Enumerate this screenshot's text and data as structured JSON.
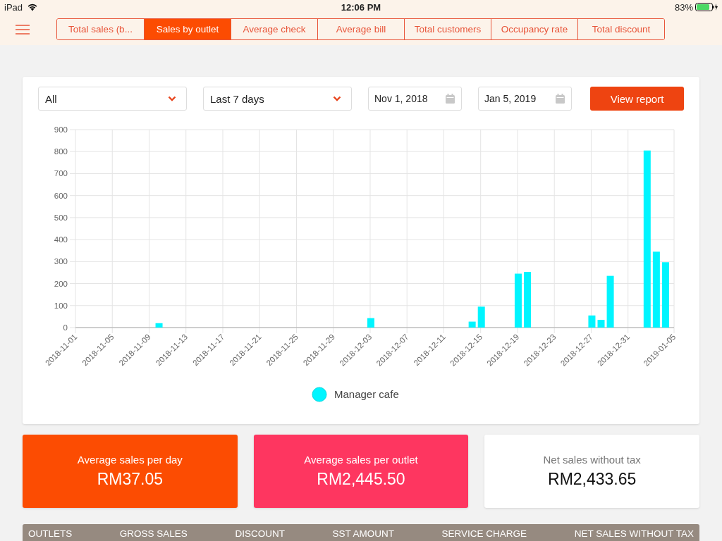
{
  "status_bar": {
    "device": "iPad",
    "time": "12:06 PM",
    "battery": "83%"
  },
  "tabs": [
    {
      "label": "Total sales (b...",
      "selected": false
    },
    {
      "label": "Sales by outlet",
      "selected": true
    },
    {
      "label": "Average check",
      "selected": false
    },
    {
      "label": "Average bill",
      "selected": false
    },
    {
      "label": "Total customers",
      "selected": false
    },
    {
      "label": "Occupancy rate",
      "selected": false
    },
    {
      "label": "Total discount",
      "selected": false
    }
  ],
  "filters": {
    "outlet": "All",
    "period": "Last 7 days",
    "start_date": "Nov 1, 2018",
    "end_date": "Jan 5, 2019",
    "button": "View report"
  },
  "chart_data": {
    "type": "bar",
    "grid": true,
    "categories": [
      "2018-11-01",
      null,
      null,
      null,
      "2018-11-05",
      null,
      null,
      null,
      "2018-11-09",
      null,
      null,
      null,
      "2018-11-13",
      null,
      null,
      null,
      "2018-11-17",
      null,
      null,
      null,
      "2018-11-21",
      null,
      null,
      null,
      "2018-11-25",
      null,
      null,
      null,
      "2018-11-29",
      null,
      null,
      null,
      "2018-12-03",
      null,
      null,
      null,
      "2018-12-07",
      null,
      null,
      null,
      "2018-12-11",
      null,
      null,
      null,
      "2018-12-15",
      null,
      null,
      null,
      "2018-12-19",
      null,
      null,
      null,
      "2018-12-23",
      null,
      null,
      null,
      "2018-12-27",
      null,
      null,
      null,
      "2018-12-31",
      null,
      null,
      null,
      null,
      "2019-01-05"
    ],
    "series": [
      {
        "name": "Manager cafe",
        "color": "#00f5ff",
        "values": [
          null,
          null,
          null,
          null,
          null,
          null,
          null,
          null,
          null,
          20,
          null,
          null,
          null,
          null,
          null,
          null,
          null,
          null,
          null,
          null,
          null,
          null,
          null,
          null,
          null,
          null,
          null,
          null,
          null,
          null,
          null,
          null,
          43,
          null,
          null,
          null,
          null,
          null,
          null,
          null,
          null,
          null,
          null,
          27,
          95,
          null,
          null,
          null,
          245,
          253,
          null,
          null,
          null,
          null,
          null,
          null,
          55,
          35,
          235,
          null,
          null,
          null,
          805,
          345,
          297,
          null
        ]
      }
    ],
    "ylim": [
      0,
      900
    ],
    "yticks": [
      0,
      100,
      200,
      300,
      400,
      500,
      600,
      700,
      800,
      900
    ]
  },
  "kpis": [
    {
      "kind": "orange",
      "label": "Average sales per day",
      "value": "RM37.05"
    },
    {
      "kind": "pink",
      "label": "Average sales per outlet",
      "value": "RM2,445.50"
    },
    {
      "kind": "plain",
      "label": "Net sales without tax",
      "value": "RM2,433.65"
    }
  ],
  "table": {
    "columns": [
      "OUTLETS",
      "GROSS SALES",
      "DISCOUNT",
      "SST AMOUNT",
      "SERVICE CHARGE",
      "NET SALES WITHOUT TAX"
    ]
  }
}
